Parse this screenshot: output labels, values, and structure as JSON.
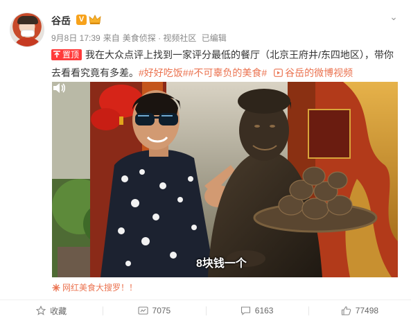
{
  "user": {
    "name": "谷岳",
    "verified_label": "V"
  },
  "meta": {
    "date": "9月8日 17:39",
    "from_prefix": "来自",
    "source": "美食侦探 · 视频社区",
    "edited": "已编辑"
  },
  "post": {
    "pin_label": "置顶",
    "text": "我在大众点评上找到一家评分最低的餐厅（北京王府井/东四地区），带你去看看究竟有多差。",
    "hashtags": [
      "#好好吃饭#",
      "#不可辜负的美食#"
    ],
    "video_link": "谷岳的微博视频"
  },
  "video": {
    "subtitle": "8块钱一个"
  },
  "source_tag": "网红美食大搜罗！！",
  "actions": {
    "favorite": "收藏",
    "repost": "7075",
    "comment": "6163",
    "like": "77498"
  },
  "colors": {
    "accent": "#eb7350",
    "pin": "#ff3b3b",
    "verified": "#f7a21b"
  }
}
